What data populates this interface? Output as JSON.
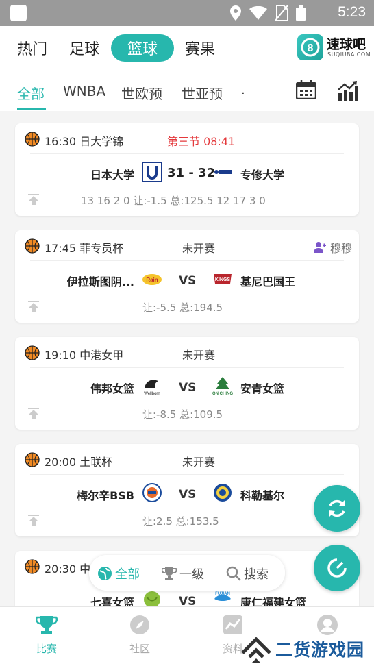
{
  "status_bar": {
    "time": "5:23"
  },
  "top_tabs": [
    "热门",
    "足球",
    "篮球",
    "赛果"
  ],
  "active_top_tab": "篮球",
  "brand": {
    "name": "速球吧",
    "sub": "SUQIUBA.COM"
  },
  "sub_tabs": [
    "全部",
    "WNBA",
    "世欧预",
    "世亚预",
    "."
  ],
  "matches": [
    {
      "time_league": "16:30 日大学锦",
      "status": "第三节  08:41",
      "home": "日本大学",
      "away": "专修大学",
      "score": "31 - 32",
      "odds": "13  16  2  0   让:-1.5    总:125.5  12  17  3  0"
    },
    {
      "time_league": "17:45 菲专员杯",
      "status": "未开赛",
      "follow": "穆穆",
      "home": "伊拉斯图阴...",
      "away": "基尼巴国王",
      "vs": "VS",
      "odds": "让:-5.5     总:194.5"
    },
    {
      "time_league": "19:10 中港女甲",
      "status": "未开赛",
      "home": "伟邦女篮",
      "away": "安青女篮",
      "vs": "VS",
      "odds": "让:-8.5     总:109.5"
    },
    {
      "time_league": "20:00 土联杯",
      "status": "未开赛",
      "home": "梅尔辛BSB",
      "away": "科勒基尔",
      "vs": "VS",
      "odds": "让:2.5      总:153.5"
    },
    {
      "time_league": "20:30 中",
      "home": "七喜女篮",
      "away": "康仁福建女篮",
      "vs": "VS"
    }
  ],
  "filter": {
    "all": "全部",
    "level1": "一级",
    "search": "搜索"
  },
  "bottom_nav": [
    "比赛",
    "社区",
    "资料",
    ""
  ],
  "watermark": "二货游戏园",
  "colors": {
    "accent": "#27b7ad",
    "live": "#e4393c"
  }
}
